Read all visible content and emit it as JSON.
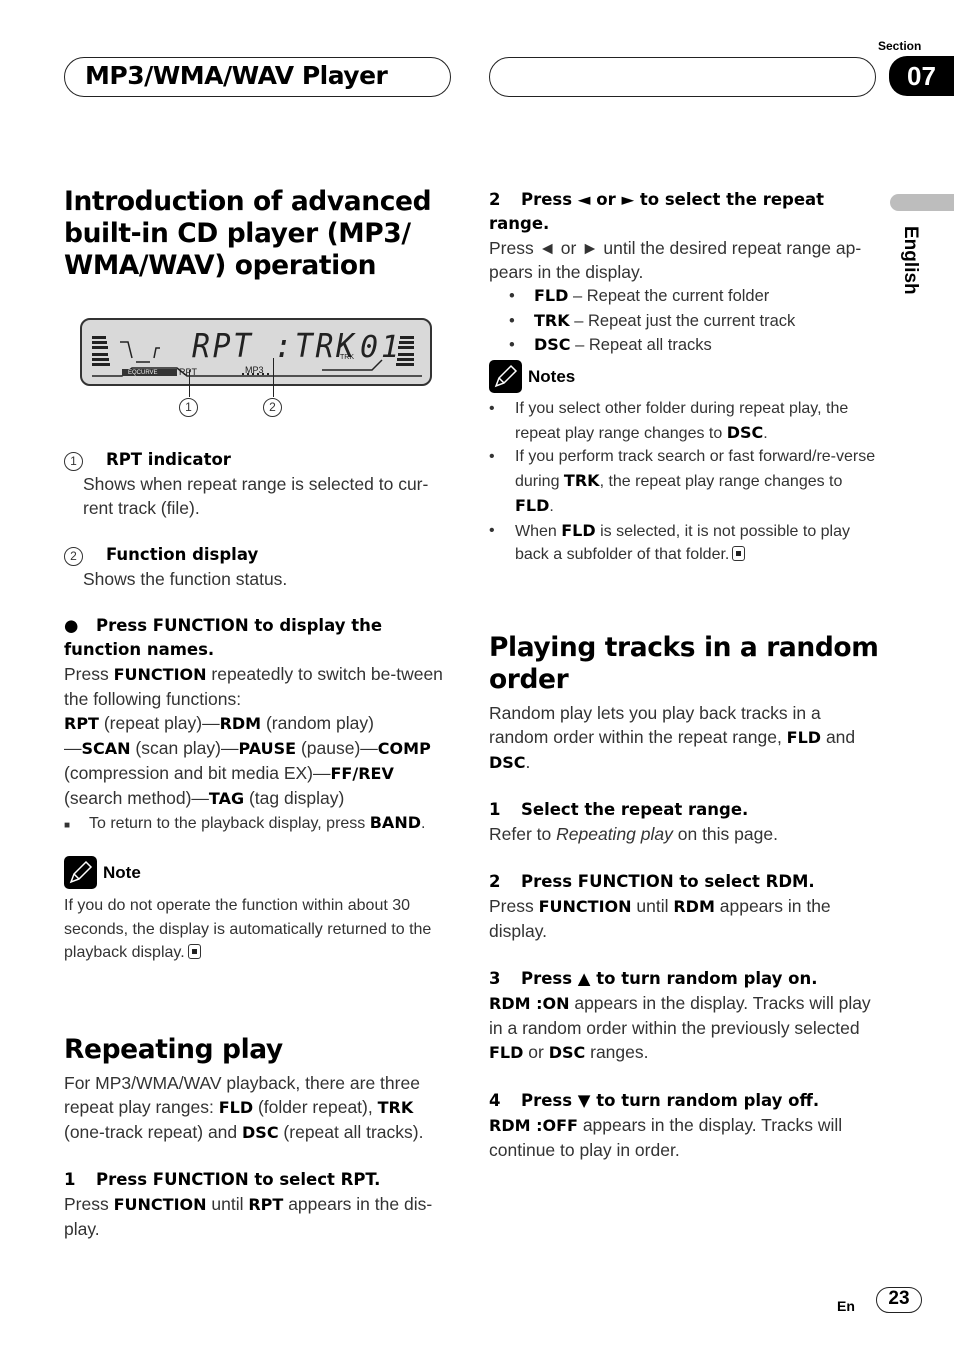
{
  "header": {
    "title": "MP3/WMA/WAV Player",
    "section_label": "Section",
    "section_number": "07"
  },
  "side_tab": {
    "language": "English"
  },
  "left": {
    "intro_heading": "Introduction of advanced built-in CD player (MP3/ WMA/WAV) operation",
    "display": {
      "main_text": "RPT :TRK",
      "small_trk": "TRK",
      "track_number": "01",
      "eq_label": "EQCURVE",
      "rpt_label": "RPT",
      "mp3_label": "MP3",
      "callouts": [
        "1",
        "2"
      ]
    },
    "legend": [
      {
        "num": "1",
        "title": "RPT indicator",
        "desc": "Shows when repeat range is selected to cur-rent track (file)."
      },
      {
        "num": "2",
        "title": "Function display",
        "desc": "Shows the function status."
      }
    ],
    "function_step": {
      "title": "Press FUNCTION to display the function names.",
      "p1_pre": "Press ",
      "p1_b": "FUNCTION",
      "p1_post": " repeatedly to switch be-tween the following functions:",
      "functions": [
        {
          "name": "RPT",
          "desc": " (repeat play)"
        },
        {
          "name": "RDM",
          "desc": " (random play)"
        },
        {
          "name": "SCAN",
          "desc": " (scan play)"
        },
        {
          "name": "PAUSE",
          "desc": " (pause)"
        },
        {
          "name": "COMP",
          "desc": ""
        },
        {
          "name": "",
          "desc": "(compression and bit media EX)"
        },
        {
          "name": "FF/REV",
          "desc": ""
        },
        {
          "name": "",
          "desc": "(search method)"
        },
        {
          "name": "TAG",
          "desc": " (tag display)"
        }
      ],
      "sub_note_pre": "To return to the playback display, press ",
      "sub_note_b": "BAND",
      "sub_note_post": "."
    },
    "note": {
      "title": "Note",
      "text": "If you do not operate the function within about 30 seconds, the display is automatically returned to the playback display."
    },
    "repeating": {
      "heading": "Repeating play",
      "intro_1": "For MP3/WMA/WAV playback, there are three repeat play ranges: ",
      "fld": "FLD",
      "fld_desc": " (folder repeat), ",
      "trk": "TRK",
      "trk_desc": " (one-track repeat) and ",
      "dsc": "DSC",
      "dsc_desc": " (repeat all tracks).",
      "step1_num": "1",
      "step1_title": "Press FUNCTION to select RPT.",
      "step1_pre": "Press ",
      "step1_b1": "FUNCTION",
      "step1_mid": " until ",
      "step1_b2": "RPT",
      "step1_post": " appears in the dis-play."
    }
  },
  "right": {
    "step2": {
      "num": "2",
      "title": "Press ◄ or ► to select the repeat range.",
      "text": "Press ◄ or ► until the desired repeat range ap-pears in the display.",
      "options": [
        {
          "code": "FLD",
          "desc": " – Repeat the current folder"
        },
        {
          "code": "TRK",
          "desc": " – Repeat just the current track"
        },
        {
          "code": "DSC",
          "desc": " – Repeat all tracks"
        }
      ]
    },
    "notes": {
      "title": "Notes",
      "items": [
        {
          "pre": "If you select other folder during repeat play, the repeat play range changes to ",
          "b": "DSC",
          "post": "."
        },
        {
          "pre": "If you perform track search or fast forward/re-verse during ",
          "b": "TRK",
          "post": ", the repeat play range changes to ",
          "b2": "FLD",
          "post2": "."
        },
        {
          "pre": "When ",
          "b": "FLD",
          "post": " is selected, it is not possible to play back a subfolder of that folder."
        }
      ]
    },
    "random": {
      "heading": "Playing tracks in a random order",
      "intro_pre": "Random play lets you play back tracks in a random order within the repeat range, ",
      "intro_b1": "FLD",
      "intro_mid": " and ",
      "intro_b2": "DSC",
      "intro_post": ".",
      "steps": [
        {
          "num": "1",
          "title": "Select the repeat range.",
          "pre": "Refer to ",
          "italic": "Repeating play",
          "post": " on this page."
        },
        {
          "num": "2",
          "title": "Press FUNCTION to select RDM.",
          "pre": "Press ",
          "b1": "FUNCTION",
          "mid": " until ",
          "b2": "RDM",
          "post": " appears in the display."
        },
        {
          "num": "3",
          "title": "Press ▲ to turn random play on.",
          "b1": "RDM :ON",
          "pre2": " appears in the display. Tracks will play in a random order within the previously selected ",
          "b2": "FLD",
          "mid": " or ",
          "b3": "DSC",
          "post": " ranges."
        },
        {
          "num": "4",
          "title": "Press ▼ to turn random play off.",
          "b1": "RDM :OFF",
          "post": " appears in the display. Tracks will continue to play in order."
        }
      ]
    }
  },
  "footer": {
    "lang": "En",
    "page": "23"
  }
}
